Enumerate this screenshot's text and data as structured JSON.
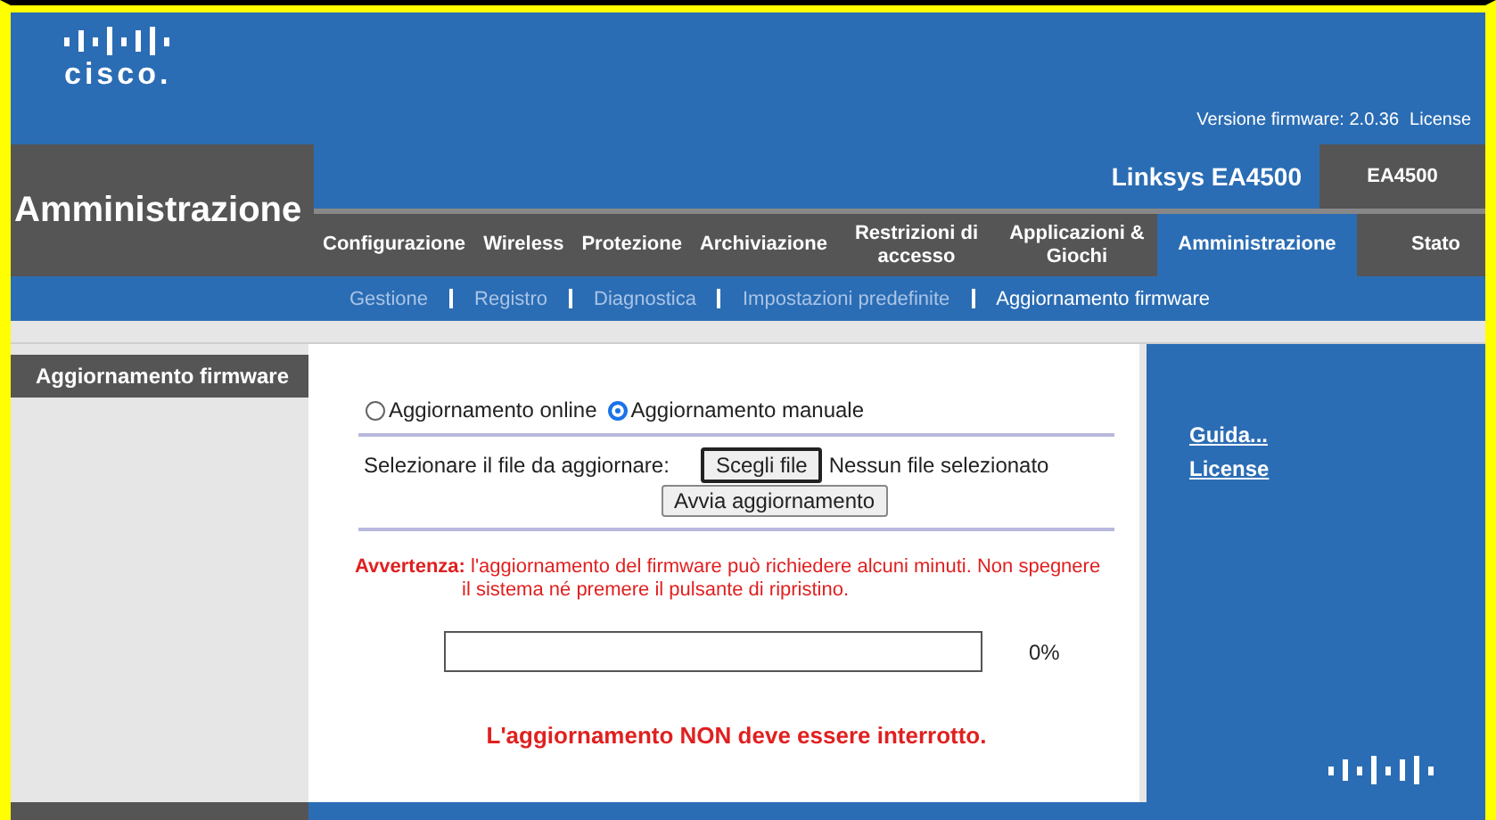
{
  "header": {
    "logo_text": "cisco.",
    "firmware_label": "Versione firmware: 2.0.36",
    "license_link": "License"
  },
  "section_title": "Amministrazione",
  "product": {
    "name": "Linksys EA4500",
    "model": "EA4500"
  },
  "tabs": [
    {
      "label": "Configurazione",
      "selected": false
    },
    {
      "label": "Wireless",
      "selected": false
    },
    {
      "label": "Protezione",
      "selected": false
    },
    {
      "label": "Archiviazione",
      "selected": false
    },
    {
      "label": "Restrizioni di accesso",
      "selected": false
    },
    {
      "label": "Applicazioni & Giochi",
      "selected": false
    },
    {
      "label": "Amministrazione",
      "selected": true
    },
    {
      "label": "Stato",
      "selected": false
    }
  ],
  "subtabs": [
    {
      "label": "Gestione",
      "selected": false
    },
    {
      "label": "Registro",
      "selected": false
    },
    {
      "label": "Diagnostica",
      "selected": false
    },
    {
      "label": "Impostazioni predefinite",
      "selected": false
    },
    {
      "label": "Aggiornamento firmware",
      "selected": true
    }
  ],
  "sidebar": {
    "title": "Aggiornamento firmware"
  },
  "update_mode": [
    {
      "label": "Aggiornamento online",
      "selected": false
    },
    {
      "label": "Aggiornamento manuale",
      "selected": true
    }
  ],
  "file": {
    "label": "Selezionare il file da aggiornare:",
    "choose_button": "Scegli file",
    "status": "Nessun file selezionato",
    "start_button": "Avvia aggiornamento"
  },
  "warning": "**Avvertenza:** l'aggiornamento del firmware può richiedere alcuni minuti. Non spegnere il sistema né premere il pulsante di ripristino.",
  "progress": {
    "level": 0,
    "reading": "0%"
  },
  "notice": "L'aggiornamento NON deve essere interrotto.",
  "help_links": [
    "Guida...",
    "License"
  ]
}
